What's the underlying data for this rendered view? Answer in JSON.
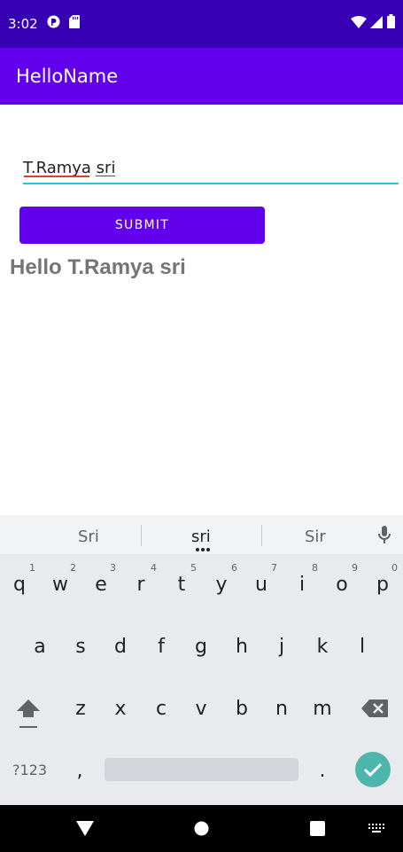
{
  "status_bar": {
    "time": "3:02"
  },
  "app_bar": {
    "title": "HelloName"
  },
  "form": {
    "name_value": "T.Ramya sri",
    "submit_label": "SUBMIT",
    "greeting": "Hello T.Ramya sri"
  },
  "keyboard": {
    "suggestions": [
      "Sri",
      "sri",
      "Sir"
    ],
    "row1": [
      {
        "key": "q",
        "hint": "1"
      },
      {
        "key": "w",
        "hint": "2"
      },
      {
        "key": "e",
        "hint": "3"
      },
      {
        "key": "r",
        "hint": "4"
      },
      {
        "key": "t",
        "hint": "5"
      },
      {
        "key": "y",
        "hint": "6"
      },
      {
        "key": "u",
        "hint": "7"
      },
      {
        "key": "i",
        "hint": "8"
      },
      {
        "key": "o",
        "hint": "9"
      },
      {
        "key": "p",
        "hint": "0"
      }
    ],
    "row2": [
      "a",
      "s",
      "d",
      "f",
      "g",
      "h",
      "j",
      "k",
      "l"
    ],
    "row3": [
      "z",
      "x",
      "c",
      "v",
      "b",
      "n",
      "m"
    ],
    "symbols_label": "?123",
    "comma": ",",
    "period": "."
  },
  "colors": {
    "status_bar": "#3700b3",
    "primary": "#6200ee",
    "input_underline": "#26c6da",
    "enter": "#4db6ac"
  }
}
